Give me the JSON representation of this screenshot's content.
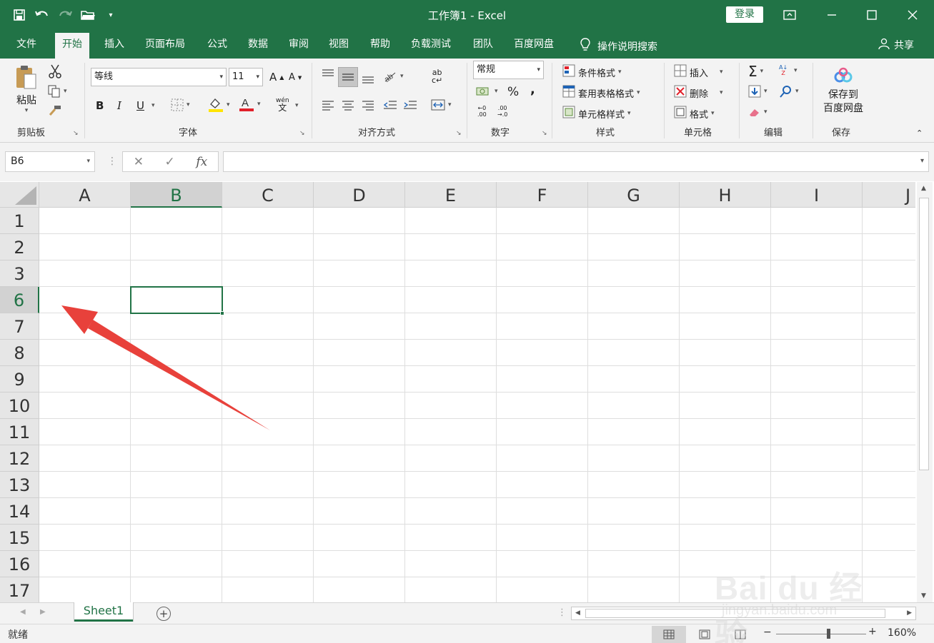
{
  "window": {
    "title": "工作簿1 - Excel",
    "login_label": "登录",
    "accent_color": "#217346"
  },
  "quick_access": [
    "save-icon",
    "undo-icon",
    "redo-icon",
    "open-folder-icon",
    "customize-qat-icon"
  ],
  "tabs": [
    {
      "label": "文件"
    },
    {
      "label": "开始",
      "active": true
    },
    {
      "label": "插入"
    },
    {
      "label": "页面布局"
    },
    {
      "label": "公式"
    },
    {
      "label": "数据"
    },
    {
      "label": "审阅"
    },
    {
      "label": "视图"
    },
    {
      "label": "帮助"
    },
    {
      "label": "负载测试"
    },
    {
      "label": "团队"
    },
    {
      "label": "百度网盘"
    }
  ],
  "tell_me": "操作说明搜索",
  "share_label": "共享",
  "ribbon": {
    "clipboard": {
      "label": "剪贴板",
      "paste_label": "粘贴"
    },
    "font": {
      "label": "字体",
      "font_name": "等线",
      "font_size": "11",
      "bold": "B",
      "italic": "I",
      "underline": "U",
      "grow": "A",
      "shrink": "A",
      "phonetic": "wén"
    },
    "alignment": {
      "label": "对齐方式"
    },
    "number": {
      "label": "数字",
      "format": "常规"
    },
    "styles": {
      "label": "样式",
      "conditional": "条件格式",
      "table_format": "套用表格格式",
      "cell_styles": "单元格样式"
    },
    "cells": {
      "label": "单元格",
      "insert": "插入",
      "delete": "删除",
      "format": "格式"
    },
    "editing": {
      "label": "编辑"
    },
    "save": {
      "label": "保存",
      "btn_line1": "保存到",
      "btn_line2": "百度网盘"
    }
  },
  "formula_bar": {
    "name_box": "B6",
    "fx": "fx",
    "formula": ""
  },
  "grid": {
    "columns": [
      "A",
      "B",
      "C",
      "D",
      "E",
      "F",
      "G",
      "H",
      "I",
      "J"
    ],
    "rows": [
      "1",
      "2",
      "3",
      "6",
      "7",
      "8",
      "9",
      "10",
      "11",
      "12",
      "13",
      "14",
      "15",
      "16",
      "17"
    ],
    "selected_column": "B",
    "selected_row": "6",
    "selected_cell": "B6"
  },
  "sheets": [
    {
      "label": "Sheet1",
      "active": true
    }
  ],
  "status": {
    "text": "就绪",
    "zoom": "160%"
  },
  "annotation": {
    "type": "arrow",
    "color": "#e8413b",
    "points_to": "row-header-6"
  },
  "watermark": {
    "brand": "Bai du",
    "brand_cn": "经验",
    "url": "jingyan.baidu.com"
  }
}
